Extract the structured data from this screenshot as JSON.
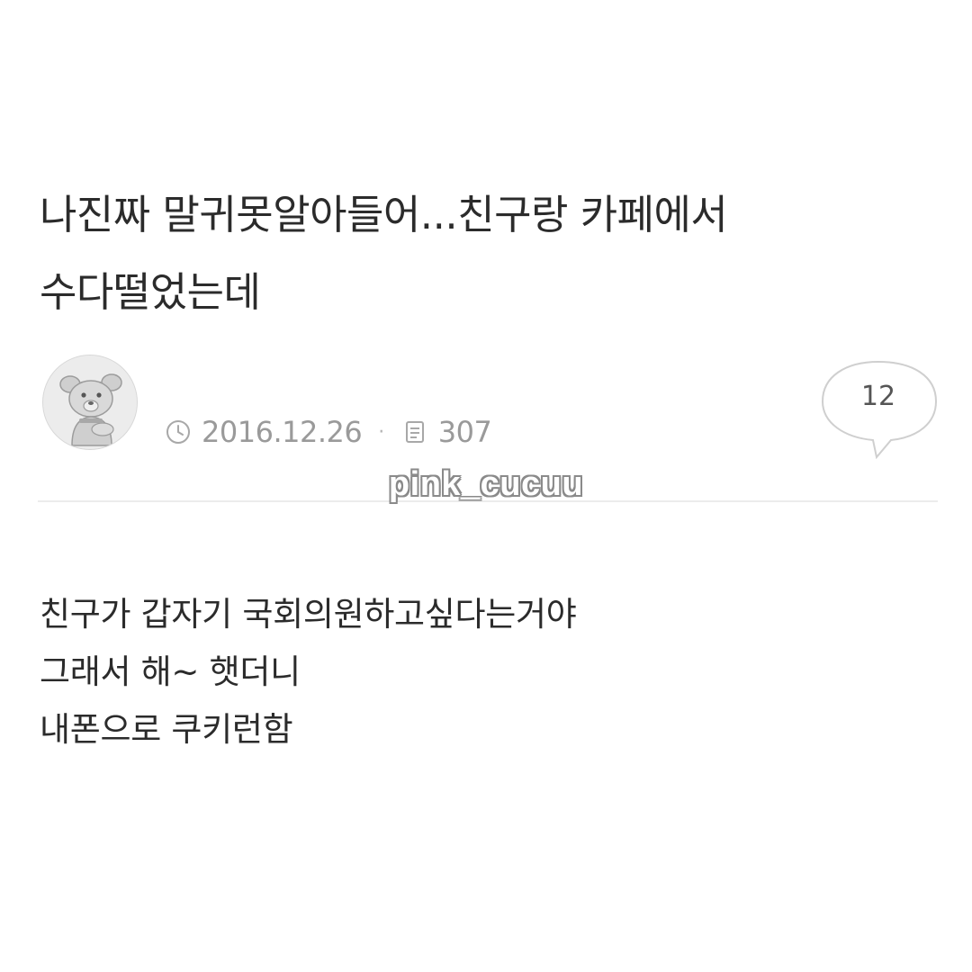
{
  "post": {
    "title_line1": "나진짜 말귀못알아들어...친구랑 카페에서",
    "title_line2": "수다떨었는데",
    "date": "2016.12.26",
    "views": "307",
    "comment_count": "12",
    "body_lines": [
      "친구가 갑자기 국회의원하고싶다는거야",
      "그래서 해~ 햇더니",
      "내폰으로 쿠키런함"
    ]
  },
  "watermark": "pink_cucuu",
  "icons": {
    "avatar": "dog-avatar-icon",
    "date": "clock-icon",
    "views": "document-icon",
    "comments": "speech-bubble-icon"
  }
}
